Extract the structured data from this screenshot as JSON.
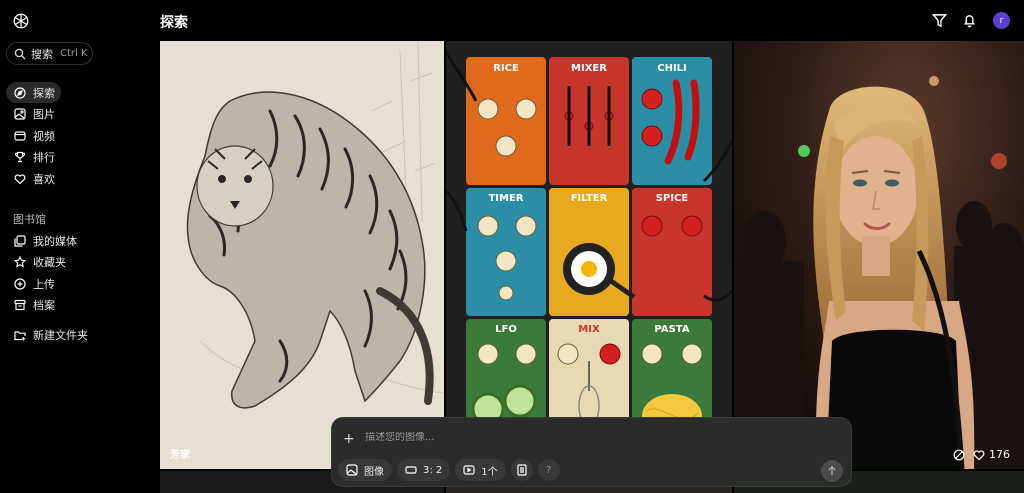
{
  "app": {
    "title": "探索"
  },
  "search": {
    "label": "搜索",
    "shortcut": "Ctrl K"
  },
  "sidebar": {
    "nav": [
      {
        "label": "探索",
        "icon": "compass-icon"
      },
      {
        "label": "图片",
        "icon": "image-icon"
      },
      {
        "label": "视频",
        "icon": "video-icon"
      },
      {
        "label": "排行",
        "icon": "trophy-icon"
      },
      {
        "label": "喜欢",
        "icon": "heart-icon"
      }
    ],
    "library_title": "图书馆",
    "library": [
      {
        "label": "我的媒体",
        "icon": "media-icon"
      },
      {
        "label": "收藏夹",
        "icon": "star-icon"
      },
      {
        "label": "上传",
        "icon": "upload-icon"
      },
      {
        "label": "档案",
        "icon": "archive-icon"
      }
    ],
    "new_folder": "新建文件夹"
  },
  "gallery": {
    "tiles": [
      {
        "caption": "芳家",
        "image": "pencil sketch of tiger"
      },
      {
        "image": "synth module grid: RICE, MIXER, CHILI, TIMER, FILTER, SPICE, LFO, MIX, PASTA"
      },
      {
        "image": "woman in nightclub",
        "likes": "176"
      }
    ]
  },
  "prompt": {
    "placeholder": "描述您的图像...",
    "chips": {
      "type": "图像",
      "ratio": "3: 2",
      "count": "1个",
      "help": "?"
    }
  },
  "colors": {
    "accent": "#5b3fd0",
    "panel": "#2b2b2b"
  }
}
